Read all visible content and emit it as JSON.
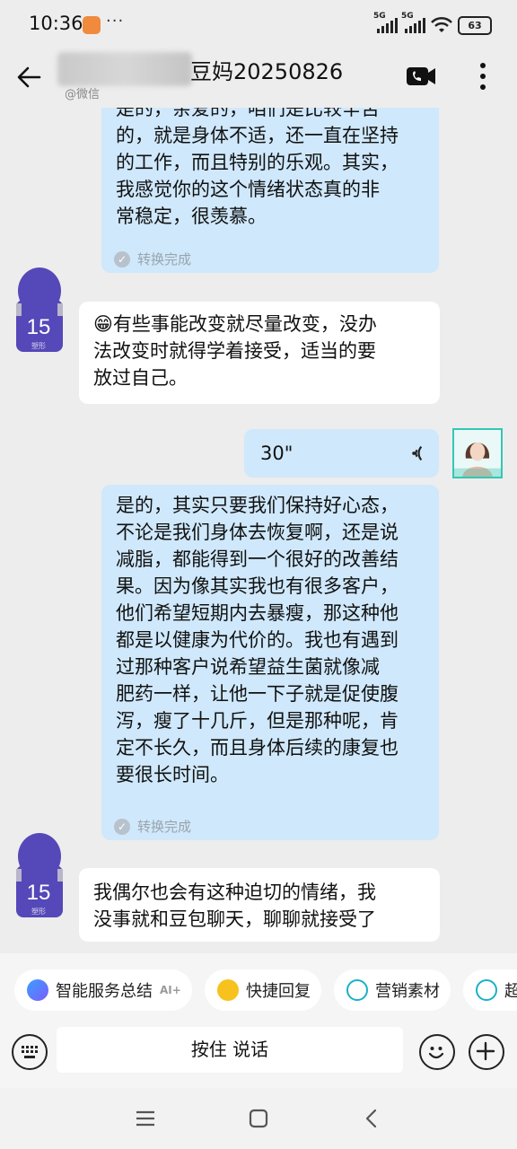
{
  "status_bar": {
    "time": "10:36",
    "more": "···",
    "sig1": "5G",
    "sig2": "5G",
    "battery": "63"
  },
  "header": {
    "title": "豆妈20250826",
    "subtitle": "@微信",
    "icons": [
      "back-arrow-icon",
      "video-call-icon",
      "more-vertical-icon"
    ]
  },
  "messages": [
    {
      "side": "right",
      "lines": [
        "是的，亲爱的，咱们是比较辛苦",
        "的，就是身体不适，还一直在坚持",
        "的工作，而且特别的乐观。其实，",
        "我感觉你的这个情绪状态真的非",
        "常稳定，很羡慕。"
      ],
      "status": "转换完成"
    },
    {
      "side": "left",
      "emoji": "😁",
      "lines": [
        "有些事能改变就尽量改变，没办",
        "法改变时就得学着接受，适当的要",
        "放过自己。"
      ]
    },
    {
      "side": "right",
      "voice": "30\""
    },
    {
      "side": "right",
      "lines": [
        "是的，其实只要我们保持好心态，",
        "不论是我们身体去恢复啊，还是说",
        "减脂，都能得到一个很好的改善结",
        "果。因为像其实我也有很多客户，",
        "他们希望短期内去暴瘦，那这种他",
        "都是以健康为代价的。我也有遇到",
        "过那种客户说希望益生菌就像减",
        "肥药一样，让他一下子就是促使腹",
        "泻，瘦了十几斤，但是那种呢，肯",
        "定不长久，而且身体后续的康复也",
        "要很长时间。"
      ],
      "status": "转换完成"
    },
    {
      "side": "left",
      "lines": [
        "我偶尔也会有这种迫切的情绪，我",
        "没事就和豆包聊天，聊聊就接受了"
      ]
    }
  ],
  "avatar_badge": "15",
  "avatar_sub": "塑形",
  "quick_actions": [
    {
      "label": "智能服务总结",
      "badge": "AI+",
      "icon": "ai-sparkle-icon"
    },
    {
      "label": "快捷回复",
      "icon": "quick-reply-icon"
    },
    {
      "label": "营销素材",
      "icon": "marketing-material-icon"
    },
    {
      "label": "超",
      "icon": "marketing-icon"
    }
  ],
  "input": {
    "hold_to_talk": "按住 说话"
  },
  "colors": {
    "background": "#ededed",
    "bubble_right": "#cfe8fb",
    "bubble_left": "#ffffff",
    "status_gray": "#9aa4ad",
    "avatar_purple": "#5548b8"
  }
}
